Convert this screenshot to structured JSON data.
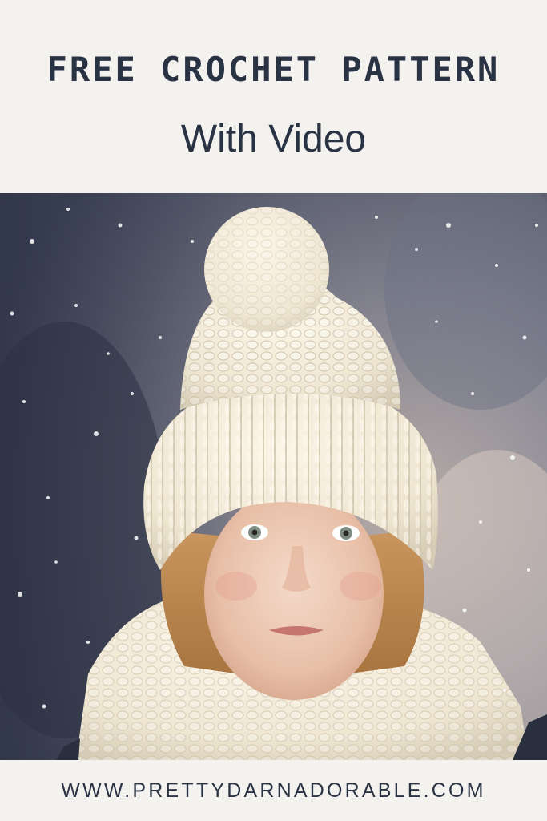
{
  "header": {
    "headline": "FREE CROCHET PATTERN",
    "subhead": "With Video"
  },
  "photo": {
    "subject": "child-in-cream-knit-pom-pom-hat-and-scarf-in-snow"
  },
  "footer": {
    "site_url": "WWW.PRETTYDARNADORABLE.COM"
  },
  "colors": {
    "background": "#f4f2ef",
    "text": "#2a3344",
    "yarn": "#efe6d2",
    "sky": "#5a6478"
  }
}
